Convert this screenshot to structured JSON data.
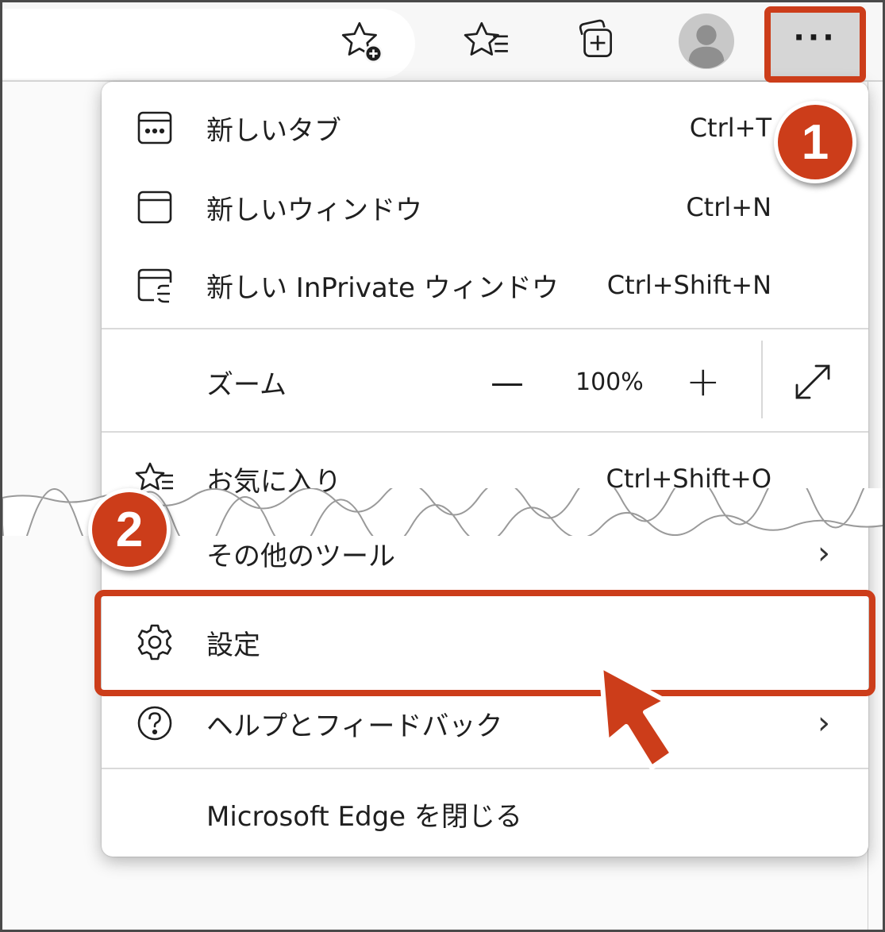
{
  "toolbar": {
    "icons": [
      "add-favorite-icon",
      "favorites-icon",
      "collections-icon",
      "profile-icon",
      "more-menu-icon"
    ],
    "more_label": "···"
  },
  "menu": {
    "new_tab": {
      "label": "新しいタブ",
      "shortcut": "Ctrl+T",
      "icon": "new-tab-icon"
    },
    "new_window": {
      "label": "新しいウィンドウ",
      "shortcut": "Ctrl+N",
      "icon": "new-window-icon"
    },
    "new_inprivate": {
      "label": "新しい InPrivate ウィンドウ",
      "shortcut": "Ctrl+Shift+N",
      "icon": "inprivate-window-icon"
    },
    "zoom": {
      "label": "ズーム",
      "minus": "—",
      "value": "100%",
      "plus": "+",
      "icon": "fullscreen-icon"
    },
    "favorites": {
      "label": "お気に入り",
      "shortcut": "Ctrl+Shift+O",
      "icon": "favorites-icon"
    },
    "more_tools": {
      "label": "その他のツール",
      "arrow": "›"
    },
    "settings": {
      "label": "設定",
      "icon": "gear-icon"
    },
    "help": {
      "label": "ヘルプとフィードバック",
      "arrow": "›",
      "icon": "help-icon"
    },
    "close_edge": {
      "label": "Microsoft Edge を閉じる"
    }
  },
  "annotations": {
    "step1": "1",
    "step2": "2",
    "accent_color": "#cc3d1a"
  }
}
